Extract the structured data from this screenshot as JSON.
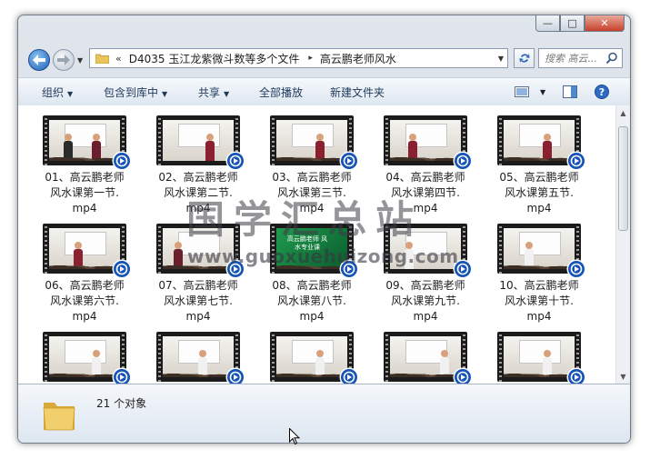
{
  "window": {
    "minimize_glyph": "—",
    "maximize_glyph": "□",
    "close_glyph": "✕"
  },
  "address": {
    "overflow_glyph": "«",
    "crumbs": [
      "D4035 玉江龙紫微斗数等多个文件",
      "高云鹏老师风水"
    ],
    "separator_glyph": "▸"
  },
  "search": {
    "placeholder": "搜索 高云..."
  },
  "toolbar": {
    "organize": "组织",
    "include_in_library": "包含到库中",
    "share": "共享",
    "play_all": "全部播放",
    "new_folder": "新建文件夹"
  },
  "files": [
    {
      "line1": "01、高云鹏老师",
      "line2": "风水课第一节.",
      "line3": "mp4"
    },
    {
      "line1": "02、高云鹏老师",
      "line2": "风水课第二节.",
      "line3": "mp4"
    },
    {
      "line1": "03、高云鹏老师",
      "line2": "风水课第三节.",
      "line3": "mp4"
    },
    {
      "line1": "04、高云鹏老师",
      "line2": "风水课第四节.",
      "line3": "mp4"
    },
    {
      "line1": "05、高云鹏老师",
      "line2": "风水课第五节.",
      "line3": "mp4"
    },
    {
      "line1": "06、高云鹏老师",
      "line2": "风水课第六节.",
      "line3": "mp4"
    },
    {
      "line1": "07、高云鹏老师",
      "line2": "风水课第七节.",
      "line3": "mp4"
    },
    {
      "line1": "08、高云鹏老师",
      "line2": "风水课第八节.",
      "line3": "mp4"
    },
    {
      "line1": "09、高云鹏老师",
      "line2": "风水课第九节.",
      "line3": "mp4"
    },
    {
      "line1": "10、高云鹏老师",
      "line2": "风水课第十节.",
      "line3": "mp4"
    },
    {
      "line1": "",
      "line2": "",
      "line3": ""
    },
    {
      "line1": "",
      "line2": "",
      "line3": ""
    },
    {
      "line1": "",
      "line2": "",
      "line3": ""
    },
    {
      "line1": "",
      "line2": "",
      "line3": ""
    },
    {
      "line1": "",
      "line2": "",
      "line3": ""
    }
  ],
  "thumb8_text": "高云鹏老师 风水专业课",
  "status": {
    "count": "21 个对象"
  },
  "watermark": {
    "title": "国学汇总站",
    "url": "www.guoxuehuizong.com"
  },
  "colors": {
    "accent": "#1e395b",
    "badge_blue": "#1553b6",
    "close_red": "#c7402a"
  }
}
